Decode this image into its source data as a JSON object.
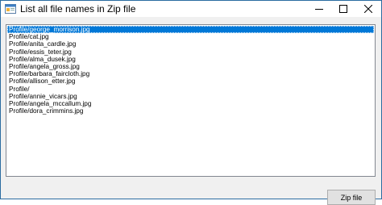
{
  "window": {
    "title": "List all file names in Zip file",
    "app_icon": "form-icon",
    "controls": {
      "minimize_icon": "minimize-icon",
      "maximize_icon": "maximize-icon",
      "close_icon": "close-icon"
    }
  },
  "listbox": {
    "selected_index": 0,
    "items": [
      "Profile/george_morrison.jpg",
      "Profile/cat.jpg",
      "Profile/anita_cardle.jpg",
      "Profile/essis_teter.jpg",
      "Profile/alma_dusek.jpg",
      "Profile/angela_gross.jpg",
      "Profile/barbara_faircloth.jpg",
      "Profile/allison_etter.jpg",
      "Profile/",
      "Profile/annie_vicars.jpg",
      "Profile/angela_mccallum.jpg",
      "Profile/dora_crimmins.jpg"
    ]
  },
  "buttons": {
    "zip_file_label": "Zip file"
  },
  "colors": {
    "selection": "#0078d7",
    "window_border": "#2b6ca1",
    "client_background": "#f0f0f0"
  }
}
